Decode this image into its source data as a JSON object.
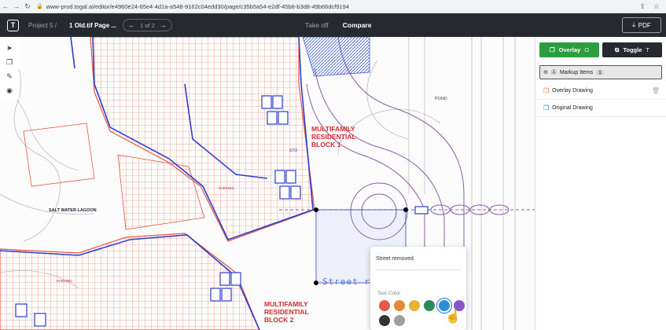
{
  "browser": {
    "url": "www-prod.togal.ai/editor/e4960e24-65e4-4d1a-a548-9162c04edd30/page/c35b5a54-e2df-45b8-b3d8-49b66dcf9194"
  },
  "header": {
    "logo": "T",
    "breadcrumb": "Project 5 /",
    "filename": "1 Old.tif Page ...",
    "pager": "1 of 2",
    "tabs": [
      {
        "label": "Take off"
      },
      {
        "label": "Compare"
      }
    ],
    "pdf_label": "PDF"
  },
  "drawing": {
    "labels": {
      "block1": "MULTIFAMILY\nRESIDENTIAL\nBLOCK 1",
      "block2": "MULTIFAMILY\nRESIDENTIAL\nBLOCK 2",
      "pond": "POND",
      "lagoon": "SALT WATER LAGOON",
      "parking_top": "PARKING",
      "parking_bottom": "PARKING",
      "sto": "STO"
    },
    "markup_text": "Street removed",
    "colors": {
      "overlay": "#e8553f",
      "original": "#2b3fd1"
    }
  },
  "popover": {
    "input_value": "Street removed",
    "text_color_label": "Text Color",
    "swatches": [
      "#e45b47",
      "#e48a3b",
      "#e3b436",
      "#2e8b57",
      "#2e8bd8",
      "#8e55c7",
      "#333333",
      "#9e9e9e"
    ],
    "selected_index": 4
  },
  "panel": {
    "overlay_label": "Overlay",
    "overlay_key": "O",
    "toggle_label": "Toggle",
    "toggle_key": "T",
    "markup_label": "Markup Items",
    "markup_count": "1",
    "items": [
      {
        "label": "Overlay Drawing"
      },
      {
        "label": "Original Drawing"
      }
    ]
  }
}
